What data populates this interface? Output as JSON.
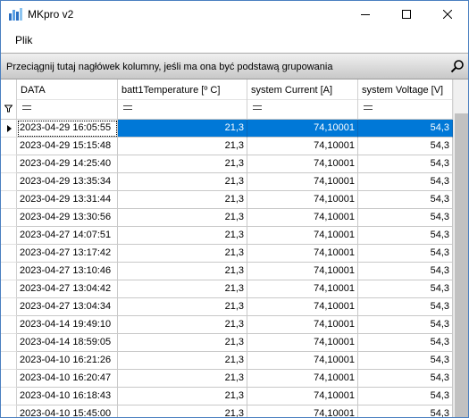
{
  "window": {
    "title": "MKpro v2",
    "icon": "mkpro-app-icon",
    "controls": [
      "minimize-icon",
      "maximize-icon",
      "close-icon"
    ]
  },
  "menu": {
    "items": [
      {
        "label": "Plik"
      }
    ]
  },
  "group_panel": {
    "text": "Przeciągnij tutaj nagłówek kolumny, jeśli ma ona być podstawą grupowania",
    "icon": "search-icon"
  },
  "grid": {
    "columns": [
      {
        "label": "DATA"
      },
      {
        "label": "batt1Temperature [º C]"
      },
      {
        "label": "system Current [A]"
      },
      {
        "label": "system Voltage [V]"
      }
    ],
    "selection_color": "#0078d7",
    "rows": [
      [
        "2023-04-29 16:05:55",
        "21,3",
        "74,10001",
        "54,3"
      ],
      [
        "2023-04-29 15:15:48",
        "21,3",
        "74,10001",
        "54,3"
      ],
      [
        "2023-04-29 14:25:40",
        "21,3",
        "74,10001",
        "54,3"
      ],
      [
        "2023-04-29 13:35:34",
        "21,3",
        "74,10001",
        "54,3"
      ],
      [
        "2023-04-29 13:31:44",
        "21,3",
        "74,10001",
        "54,3"
      ],
      [
        "2023-04-29 13:30:56",
        "21,3",
        "74,10001",
        "54,3"
      ],
      [
        "2023-04-27 14:07:51",
        "21,3",
        "74,10001",
        "54,3"
      ],
      [
        "2023-04-27 13:17:42",
        "21,3",
        "74,10001",
        "54,3"
      ],
      [
        "2023-04-27 13:10:46",
        "21,3",
        "74,10001",
        "54,3"
      ],
      [
        "2023-04-27 13:04:42",
        "21,3",
        "74,10001",
        "54,3"
      ],
      [
        "2023-04-27 13:04:34",
        "21,3",
        "74,10001",
        "54,3"
      ],
      [
        "2023-04-14 19:49:10",
        "21,3",
        "74,10001",
        "54,3"
      ],
      [
        "2023-04-14 18:59:05",
        "21,3",
        "74,10001",
        "54,3"
      ],
      [
        "2023-04-10 16:21:26",
        "21,3",
        "74,10001",
        "54,3"
      ],
      [
        "2023-04-10 16:20:47",
        "21,3",
        "74,10001",
        "54,3"
      ],
      [
        "2023-04-10 16:18:43",
        "21,3",
        "74,10001",
        "54,3"
      ],
      [
        "2023-04-10 15:45:00",
        "21,3",
        "74,10001",
        "54,3"
      ]
    ]
  }
}
